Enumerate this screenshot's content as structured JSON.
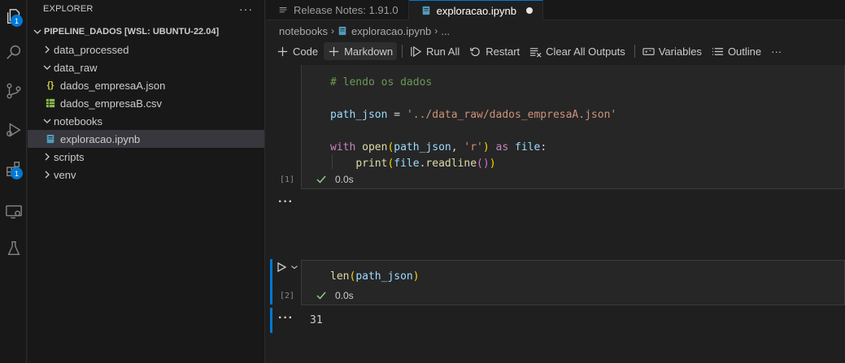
{
  "activity_bar": {
    "explorer_badge": "1",
    "extensions_badge": "1"
  },
  "sidebar": {
    "title": "EXPLORER",
    "more": "···",
    "root": "PIPELINE_DADOS [WSL: UBUNTU-22.04]",
    "items": [
      {
        "label": "data_processed",
        "type": "folder",
        "expanded": false
      },
      {
        "label": "data_raw",
        "type": "folder",
        "expanded": true
      },
      {
        "label": "dados_empresaA.json",
        "type": "json",
        "icon": "{}"
      },
      {
        "label": "dados_empresaB.csv",
        "type": "csv"
      },
      {
        "label": "notebooks",
        "type": "folder",
        "expanded": true
      },
      {
        "label": "exploracao.ipynb",
        "type": "notebook",
        "selected": true
      },
      {
        "label": "scripts",
        "type": "folder",
        "expanded": false
      },
      {
        "label": "venv",
        "type": "folder",
        "expanded": false
      }
    ]
  },
  "tabs": [
    {
      "label": "Release Notes: 1.91.0",
      "active": false
    },
    {
      "label": "exploracao.ipynb",
      "active": true,
      "dirty": true
    }
  ],
  "breadcrumb": {
    "folder": "notebooks",
    "file": "exploracao.ipynb",
    "more": "..."
  },
  "toolbar": {
    "code": "Code",
    "markdown": "Markdown",
    "run_all": "Run All",
    "restart": "Restart",
    "clear_outputs": "Clear All Outputs",
    "variables": "Variables",
    "outline": "Outline",
    "more": "···"
  },
  "cells": [
    {
      "exec_count": "[1]",
      "status_time": "0.0s",
      "lines": {
        "comment": "# lendo os dados",
        "path_var": "path_json",
        "path_eq": " = ",
        "path_str": "'../data_raw/dados_empresaA.json'",
        "with_kw": "with",
        "open_fn": "open",
        "open_args_var": "path_json",
        "open_comma": ", ",
        "open_mode": "'r'",
        "as_kw": "as",
        "file_var": "file",
        "colon": ":",
        "print_fn": "print",
        "file_var2": "file",
        "readline_fn": "readline"
      },
      "output_more": "···"
    },
    {
      "exec_count": "[2]",
      "status_time": "0.0s",
      "lines": {
        "len_fn": "len",
        "len_arg": "path_json"
      },
      "output_more": "···",
      "output": "31"
    }
  ],
  "colors": {
    "accent": "#0078d4",
    "success": "#89d185"
  }
}
